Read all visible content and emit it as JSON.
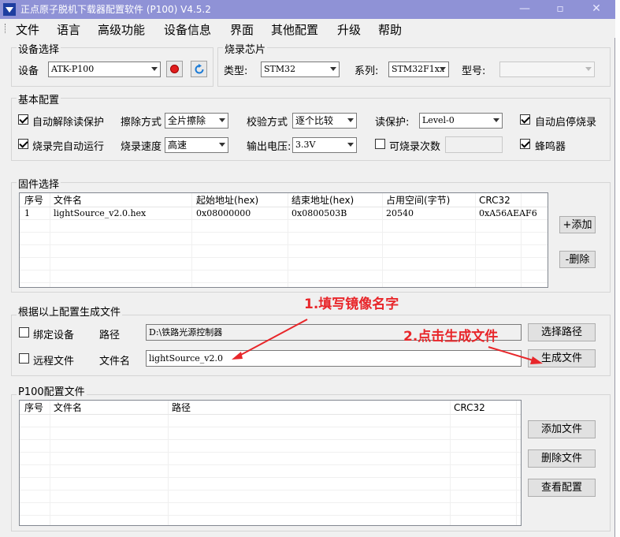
{
  "window": {
    "title": "正点原子脱机下载器配置软件 (P100)  V4.5.2"
  },
  "menu": [
    "文件",
    "语言",
    "高级功能",
    "设备信息",
    "界面",
    "其他配置",
    "升级",
    "帮助"
  ],
  "device_group": {
    "title": "设备选择",
    "device_label": "设备",
    "device_value": "ATK-P100"
  },
  "chip_group": {
    "title": "烧录芯片",
    "type_label": "类型:",
    "type_value": "STM32",
    "series_label": "系列:",
    "series_value": "STM32F1xx",
    "model_label": "型号:",
    "model_value": ""
  },
  "basic": {
    "title": "基本配置",
    "auto_unlock": "自动解除读保护",
    "auto_run": "烧录完自动运行",
    "erase_label": "擦除方式",
    "erase_value": "全片擦除",
    "speed_label": "烧录速度",
    "speed_value": "高速",
    "verify_label": "校验方式",
    "verify_value": "逐个比较",
    "voltage_label": "输出电压:",
    "voltage_value": "3.3V",
    "readprot_label": "读保护:",
    "readprot_value": "Level-0",
    "count_label": "可烧录次数",
    "auto_start": "自动启停烧录",
    "buzzer": "蜂鸣器"
  },
  "firmware": {
    "title": "固件选择",
    "columns": [
      "序号",
      "文件名",
      "起始地址(hex)",
      "结束地址(hex)",
      "占用空间(字节)",
      "CRC32"
    ],
    "rows": [
      [
        "1",
        "lightSource_v2.0.hex",
        "0x08000000",
        "0x0800503B",
        "20540",
        "0xA56AEAF6"
      ]
    ],
    "add_button": "+添加",
    "delete_button": "-删除"
  },
  "generate": {
    "title": "根据以上配置生成文件",
    "bind_device": "绑定设备",
    "path_label": "路径",
    "path_value": "D:\\铁路光源控制器",
    "select_path_button": "选择路径",
    "remote_file": "远程文件",
    "filename_label": "文件名",
    "filename_value": "lightSource_v2.0",
    "generate_button": "生成文件"
  },
  "p100": {
    "title": "P100配置文件",
    "columns": [
      "序号",
      "文件名",
      "路径",
      "CRC32"
    ],
    "add_button": "添加文件",
    "delete_button": "删除文件",
    "view_button": "查看配置"
  },
  "annotations": {
    "step1": "1.填写镜像名字",
    "step2": "2.点击生成文件",
    "color": "#e8262a"
  },
  "colors": {
    "titlebar": "#8f92d6",
    "window_bg": "#f0f0f0"
  }
}
